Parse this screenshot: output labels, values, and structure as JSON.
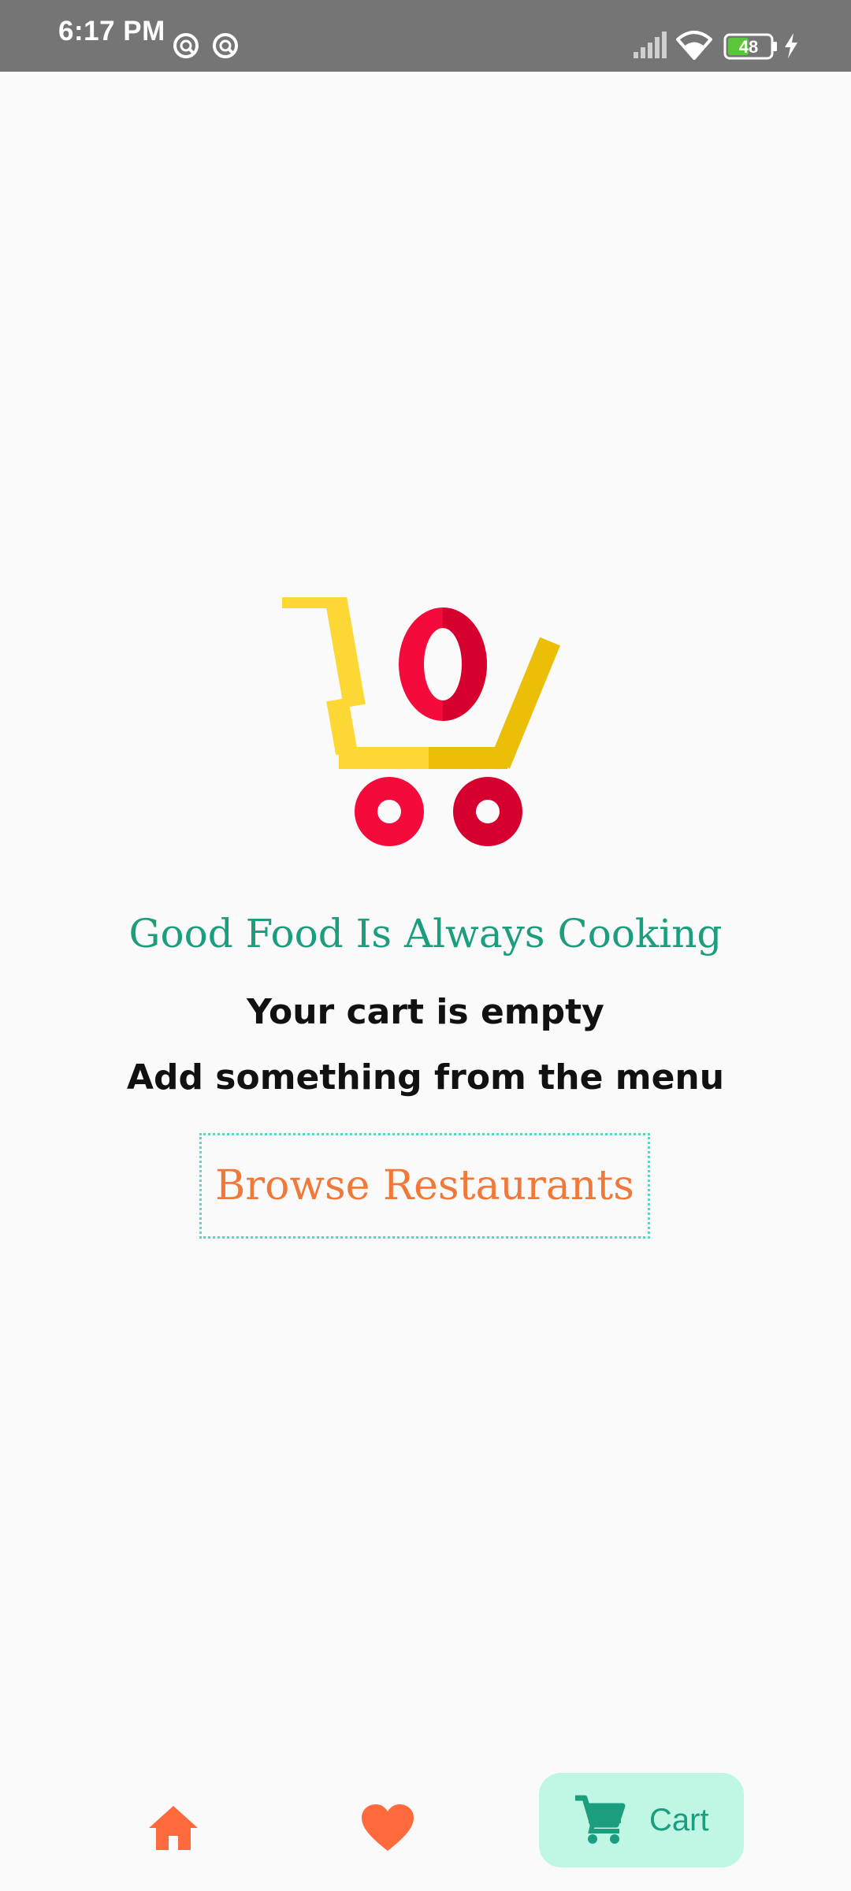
{
  "status_bar": {
    "time": "6:17 PM",
    "battery": "48",
    "notification_icons": [
      "sync-icon",
      "sync-icon"
    ],
    "system_icons": [
      "signal-icon",
      "wifi-icon",
      "battery-icon",
      "charging-icon"
    ]
  },
  "empty_state": {
    "illustration": "empty-cart-illustration",
    "headline": "Good Food Is Always Cooking",
    "line1": "Your cart is empty",
    "line2": "Add something from the menu",
    "browse_label": "Browse Restaurants"
  },
  "bottom_nav": {
    "items": [
      {
        "icon": "home-icon",
        "label": "",
        "active": false
      },
      {
        "icon": "heart-icon",
        "label": "",
        "active": false
      },
      {
        "icon": "cart-icon",
        "label": "Cart",
        "active": true
      }
    ]
  },
  "colors": {
    "status_bar_bg": "#757575",
    "background": "#fafafa",
    "accent_green": "#1b9d7e",
    "accent_orange": "#f07838",
    "nav_icon_orange": "#ff6a3d",
    "active_nav_bg": "#bff7e4",
    "cart_yellow": "#fdd835",
    "cart_red": "#f50a3c"
  }
}
